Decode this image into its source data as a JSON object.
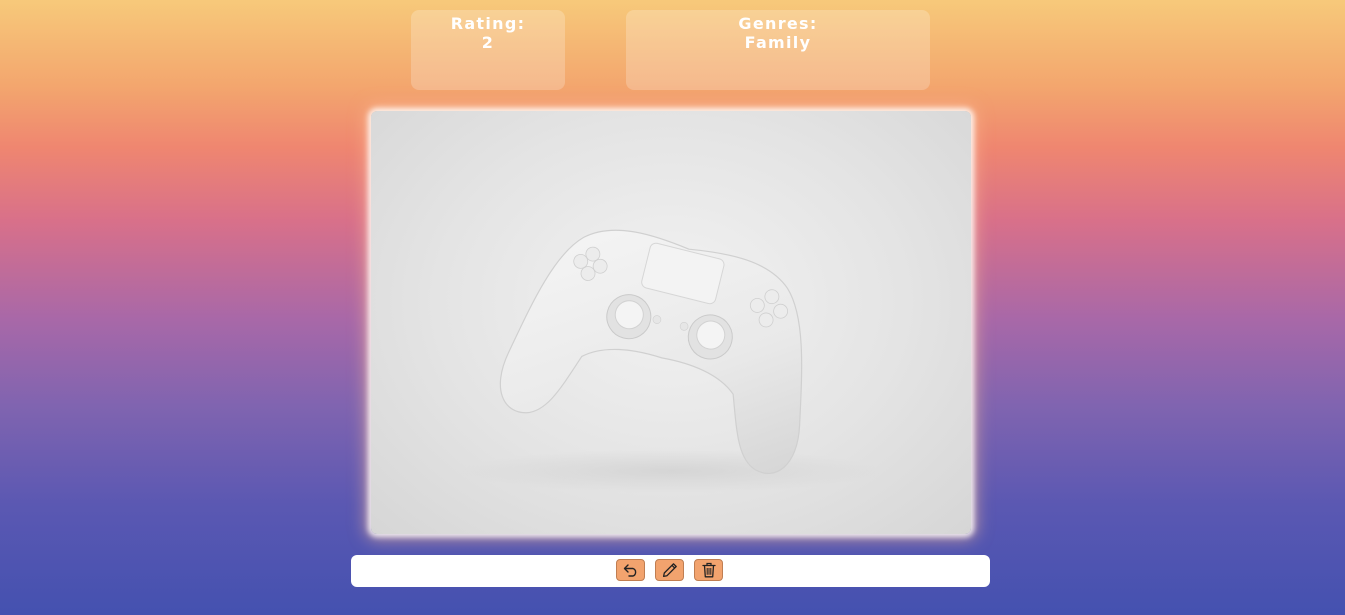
{
  "rating": {
    "label": "Rating:",
    "value": "2"
  },
  "genres": {
    "label": "Genres:",
    "value": "Family"
  },
  "image": {
    "subject": "game-controller",
    "alt": "White game controller floating on light grey background"
  },
  "toolbar": {
    "buttons": [
      {
        "name": "undo",
        "icon": "undo-icon"
      },
      {
        "name": "edit",
        "icon": "pencil-icon"
      },
      {
        "name": "delete",
        "icon": "trash-icon"
      }
    ]
  },
  "colors": {
    "button_fill": "#f2a36e",
    "card_fill": "rgba(255,255,255,0.22)",
    "gradient_top": "#f7c97a",
    "gradient_bottom": "#4451b0"
  }
}
